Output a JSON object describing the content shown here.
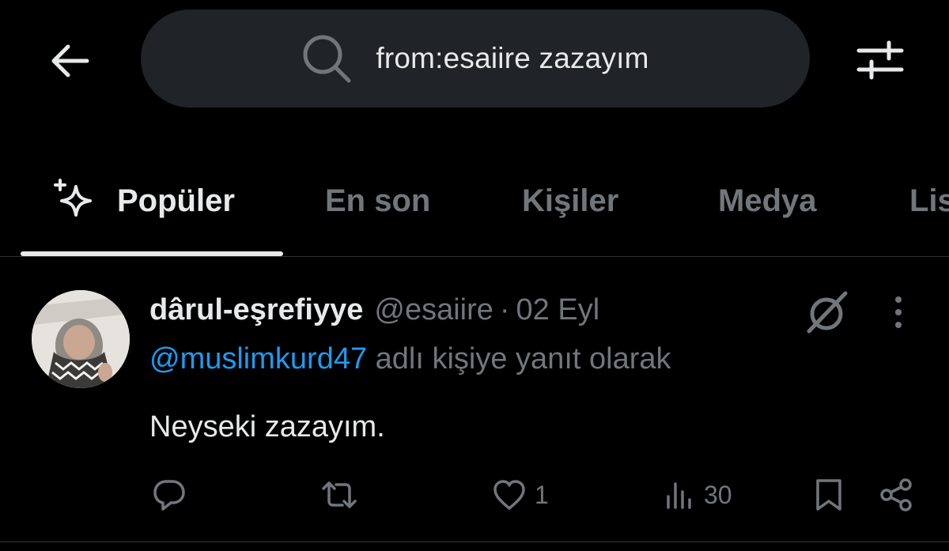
{
  "search": {
    "query": "from:esaiire zazayım"
  },
  "icons": {
    "back": "arrow-left-icon",
    "search": "search-icon",
    "filter": "sliders-icon",
    "popular": "sparkle-icon",
    "grok": "grok-icon",
    "more": "more-vertical-icon",
    "reply": "reply-icon",
    "retweet": "retweet-icon",
    "like": "heart-icon",
    "views": "views-icon",
    "bookmark": "bookmark-icon",
    "share": "share-icon"
  },
  "tabs": [
    {
      "label": "Popüler",
      "active": true
    },
    {
      "label": "En son",
      "active": false
    },
    {
      "label": "Kişiler",
      "active": false
    },
    {
      "label": "Medya",
      "active": false
    },
    {
      "label": "Listeler",
      "active": false
    }
  ],
  "tweet": {
    "display_name": "dârul-eşrefiyye",
    "handle": "@esaiire",
    "separator": "·",
    "time": "02 Eyl",
    "reply_to": "@muslimkurd47",
    "reply_suffix": "adlı kişiye yanıt olarak",
    "text": "Neyseki zazayım.",
    "likes": "1",
    "views": "30"
  },
  "colors": {
    "background": "#000000",
    "text": "#e7e9ea",
    "muted": "#71767b",
    "accent": "#1d9bf0",
    "search_bg": "#202327",
    "divider": "#2f3336"
  }
}
